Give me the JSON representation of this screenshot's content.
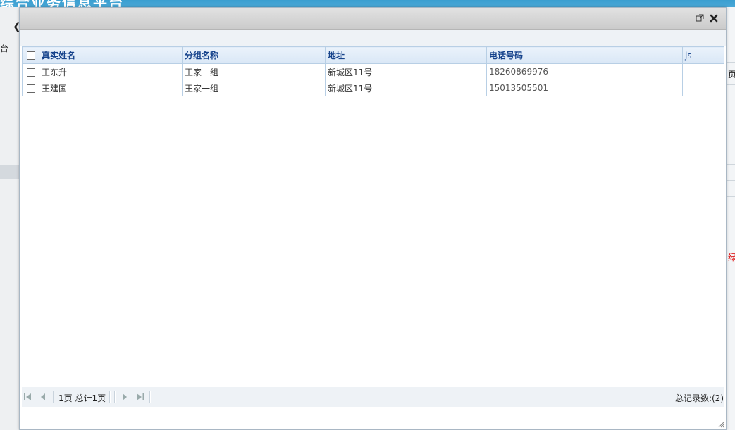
{
  "background": {
    "header_title": "综合业务信息平台",
    "left_text": "台 -",
    "right_texts": [
      "页",
      "绿公"
    ]
  },
  "dialog": {
    "title": "",
    "icons": {
      "restore": "popout-icon",
      "close": "close-icon"
    }
  },
  "grid": {
    "columns": [
      "真实姓名",
      "分组名称",
      "地址",
      "电话号码",
      "js"
    ],
    "rows": [
      {
        "name": "王东升",
        "group": "王家一组",
        "address": "新城区11号",
        "phone": "18260869976",
        "js": ""
      },
      {
        "name": "王建国",
        "group": "王家一组",
        "address": "新城区11号",
        "phone": "15013505501",
        "js": ""
      }
    ]
  },
  "pager": {
    "page_info": "1页 总计1页",
    "total_records": "总记录数:(2)"
  },
  "colors": {
    "header_text": "#15428b",
    "grid_border": "#b8cfe5",
    "background_header": "#3a9ed0"
  }
}
